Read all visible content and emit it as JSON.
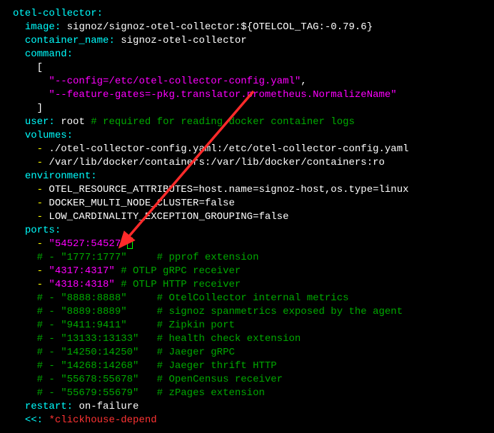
{
  "service_name": "otel-collector",
  "image_key": "image",
  "image_value": "signoz/signoz-otel-collector:${OTELCOL_TAG:-0.79.6}",
  "container_name_key": "container_name",
  "container_name_value": "signoz-otel-collector",
  "command_key": "command",
  "command_open": "[",
  "command_arg1": "\"--config=/etc/otel-collector-config.yaml\"",
  "command_comma": ",",
  "command_arg2": "\"--feature-gates=-pkg.translator.prometheus.NormalizeName\"",
  "command_close": "]",
  "user_key": "user",
  "user_value": "root",
  "user_comment": "# required for reading docker container logs",
  "volumes_key": "volumes",
  "volume1": "./otel-collector-config.yaml:/etc/otel-collector-config.yaml",
  "volume2": "/var/lib/docker/containers:/var/lib/docker/containers:ro",
  "environment_key": "environment",
  "env1": "OTEL_RESOURCE_ATTRIBUTES=host.name=signoz-host,os.type=linux",
  "env2": "DOCKER_MULTI_NODE_CLUSTER=false",
  "env3": "LOW_CARDINALITY_EXCEPTION_GROUPING=false",
  "ports_key": "ports",
  "port_active": "\"54527:54527\"",
  "port_c1_prefix": "# - \"1777:1777\"",
  "port_c1_comment": "# pprof extension",
  "port_grpc": "\"4317:4317\"",
  "port_grpc_comment": "# OTLP gRPC receiver",
  "port_http": "\"4318:4318\"",
  "port_http_comment": "# OTLP HTTP receiver",
  "port_c2_prefix": "# - \"8888:8888\"",
  "port_c2_comment": "# OtelCollector internal metrics",
  "port_c3_prefix": "# - \"8889:8889\"",
  "port_c3_comment": "# signoz spanmetrics exposed by the agent",
  "port_c4_prefix": "# - \"9411:9411\"",
  "port_c4_comment": "# Zipkin port",
  "port_c5_prefix": "# - \"13133:13133\"",
  "port_c5_comment": "# health check extension",
  "port_c6_prefix": "# - \"14250:14250\"",
  "port_c6_comment": "# Jaeger gRPC",
  "port_c7_prefix": "# - \"14268:14268\"",
  "port_c7_comment": "# Jaeger thrift HTTP",
  "port_c8_prefix": "# - \"55678:55678\"",
  "port_c8_comment": "# OpenCensus receiver",
  "port_c9_prefix": "# - \"55679:55679\"",
  "port_c9_comment": "# zPages extension",
  "restart_key": "restart",
  "restart_value": "on-failure",
  "merge_key": "<<",
  "merge_value": "*clickhouse-depend",
  "annotation": {
    "type": "arrow",
    "color": "#ff2a2a",
    "description": "red arrow pointing to the newly added port mapping 54527:54527"
  }
}
